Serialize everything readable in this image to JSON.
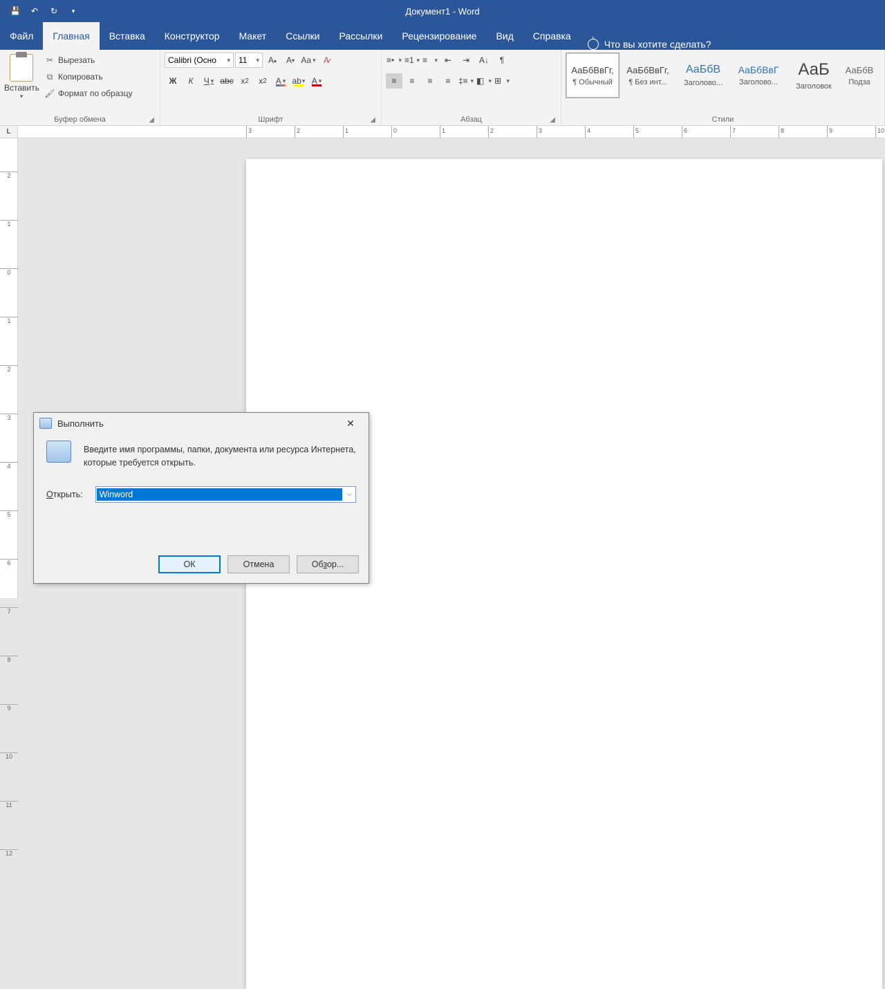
{
  "title": "Документ1  -  Word",
  "tabs": {
    "file": "Файл",
    "home": "Главная",
    "insert": "Вставка",
    "design": "Конструктор",
    "layout": "Макет",
    "references": "Ссылки",
    "mailings": "Рассылки",
    "review": "Рецензирование",
    "view": "Вид",
    "help": "Справка",
    "tellme": "Что вы хотите сделать?"
  },
  "clipboard": {
    "paste": "Вставить",
    "cut": "Вырезать",
    "copy": "Копировать",
    "format_painter": "Формат по образцу",
    "group": "Буфер обмена"
  },
  "font": {
    "name": "Calibri (Осно",
    "size": "11",
    "group": "Шрифт",
    "bold": "Ж",
    "italic": "К",
    "underline": "Ч",
    "strike": "abc",
    "sub": "x₂",
    "sup": "x²",
    "caseAa": "Aa",
    "clear": "✎"
  },
  "paragraph": {
    "group": "Абзац"
  },
  "styles": {
    "group": "Стили",
    "items": [
      {
        "sample": "АаБбВвГг,",
        "name": "¶ Обычный"
      },
      {
        "sample": "АаБбВвГг,",
        "name": "¶ Без инт..."
      },
      {
        "sample": "АаБбВ",
        "name": "Заголово..."
      },
      {
        "sample": "АаБбВвГ",
        "name": "Заголово..."
      },
      {
        "sample": "АаБ",
        "name": "Заголовок"
      },
      {
        "sample": "АаБбВ",
        "name": "Подза"
      }
    ]
  },
  "run_dialog": {
    "title": "Выполнить",
    "instruction": "Введите имя программы, папки, документа или ресурса Интернета, которые требуется открыть.",
    "open_label": "Открыть:",
    "open_value": "Winword",
    "ok": "ОК",
    "cancel": "Отмена",
    "browse": "Обзор..."
  },
  "corner": "L"
}
